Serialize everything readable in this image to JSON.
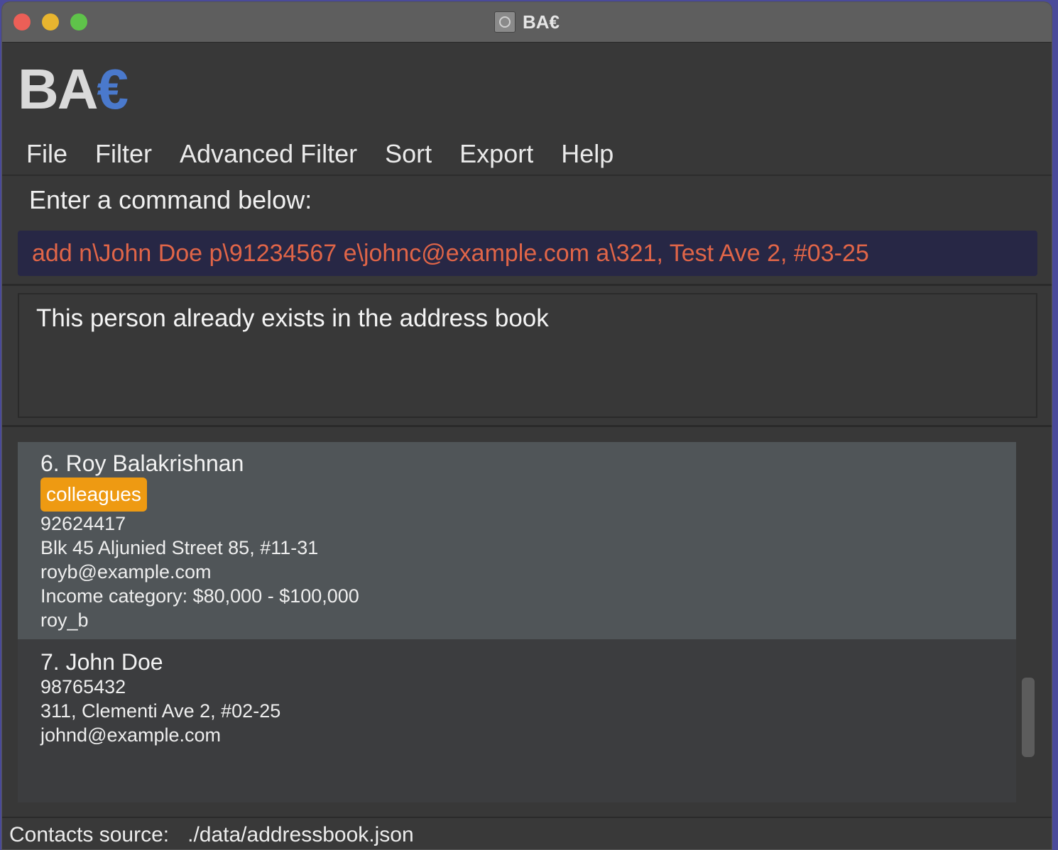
{
  "window": {
    "title": "BA€"
  },
  "logo": {
    "text": "BA",
    "accent": "€"
  },
  "menu": {
    "items": [
      "File",
      "Filter",
      "Advanced Filter",
      "Sort",
      "Export",
      "Help"
    ]
  },
  "command": {
    "label": "Enter a command below:",
    "value": "add n\\John Doe p\\91234567 e\\johnc@example.com a\\321, Test Ave 2, #03-25"
  },
  "result": {
    "message": "This person already exists in the address book"
  },
  "contacts": [
    {
      "name": "6. Roy Balakrishnan",
      "tag": "colleagues",
      "phone": "92624417",
      "address": "Blk 45 Aljunied Street 85, #11-31",
      "email": "royb@example.com",
      "income": "Income category: $80,000 - $100,000",
      "handle": "roy_b"
    },
    {
      "name": "7. John Doe",
      "phone": "98765432",
      "address": "311, Clementi Ave 2, #02-25",
      "email": "johnd@example.com"
    }
  ],
  "status": {
    "label": "Contacts source:",
    "path": "./data/addressbook.json"
  },
  "colors": {
    "background": "#383838",
    "command_text": "#e06548",
    "command_bg": "#272745",
    "tag_bg": "#ee9a12",
    "logo_accent": "#4a79cc",
    "selected_card": "#505558"
  }
}
